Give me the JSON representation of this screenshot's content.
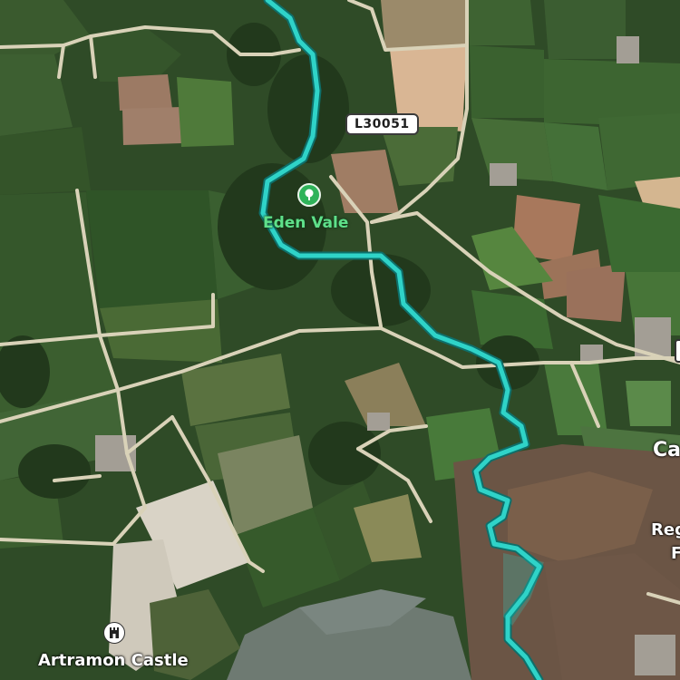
{
  "map": {
    "road_label": "L30051",
    "places": {
      "eden_vale": {
        "name": "Eden Vale",
        "icon": "tree-icon"
      },
      "artramon_castle": {
        "name": "Artramon Castle",
        "icon": "castle-icon"
      }
    },
    "edge_labels": {
      "right_town": "Ca",
      "right_reserve_line1": "Reg",
      "right_reserve_line2": "F"
    },
    "colors": {
      "route": "#2fd3c8",
      "route_outline": "#0e6f6a",
      "roads": "#d9d2b8",
      "park_icon": "#2fb35a",
      "park_label": "#5fe08a"
    }
  }
}
